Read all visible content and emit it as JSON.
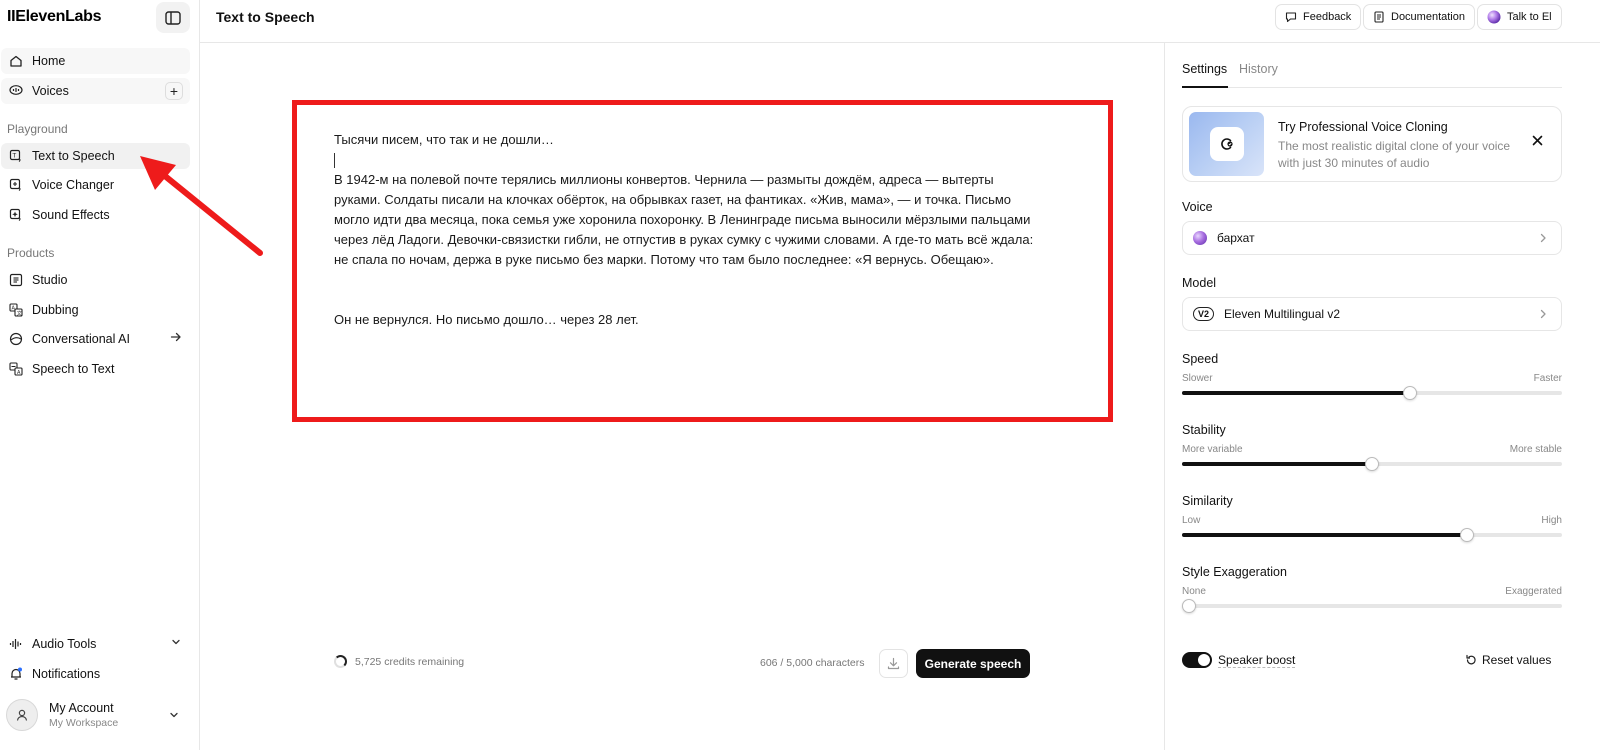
{
  "sidebar": {
    "logo": "IIElevenLabs",
    "items_top": [
      {
        "label": "Home",
        "icon": "home-icon"
      },
      {
        "label": "Voices",
        "icon": "voices-icon",
        "add": "+"
      }
    ],
    "sections": [
      {
        "label": "Playground"
      },
      {
        "label": "Products"
      }
    ],
    "playground_items": [
      {
        "label": "Text to Speech",
        "icon": "text-to-speech-icon"
      },
      {
        "label": "Voice Changer",
        "icon": "voice-changer-icon"
      },
      {
        "label": "Sound Effects",
        "icon": "sound-effects-icon"
      }
    ],
    "product_items": [
      {
        "label": "Studio",
        "icon": "studio-icon"
      },
      {
        "label": "Dubbing",
        "icon": "dubbing-icon"
      },
      {
        "label": "Conversational AI",
        "icon": "conversational-ai-icon"
      },
      {
        "label": "Speech to Text",
        "icon": "speech-to-text-icon"
      }
    ],
    "bottom_items": [
      {
        "label": "Audio Tools",
        "icon": "audio-tools-icon"
      },
      {
        "label": "Notifications",
        "icon": "bell-icon"
      }
    ],
    "account": {
      "name": "My Account",
      "workspace": "My Workspace"
    }
  },
  "header": {
    "title": "Text to Speech",
    "buttons": [
      {
        "label": "Feedback",
        "icon": "feedback-icon"
      },
      {
        "label": "Documentation",
        "icon": "document-icon"
      },
      {
        "label": "Talk to El",
        "icon": "orb-icon"
      }
    ]
  },
  "editor": {
    "paragraph1": "Тысячи писем, что так и не дошли…",
    "paragraph2": "В 1942-м на полевой почте терялись миллионы конвертов. Чернила — размыты дождём, адреса — вытерты руками. Солдаты писали на клочках обёрток, на обрывках газет, на фантиках. «Жив, мама», — и точка. Письмо могло идти два месяца, пока семья уже хоронила похоронку. В Ленинграде письма выносили мёрзлыми пальцами через лёд Ладоги. Девочки-связистки гибли, не отпустив в руках сумку с чужими словами. А где-то мать всё ждала: не спала по ночам, держа в руке письмо без марки. Потому что там было последнее: «Я вернусь. Обещаю».",
    "paragraph3": "Он не вернулся. Но письмо дошло… через 28 лет."
  },
  "footer": {
    "credits": "5,725 credits remaining",
    "characters": "606 / 5,000 characters",
    "generate_label": "Generate speech"
  },
  "settings": {
    "tabs": [
      {
        "label": "Settings"
      },
      {
        "label": "History"
      }
    ],
    "promo": {
      "title": "Try Professional Voice Cloning",
      "description": "The most realistic digital clone of your voice with just 30 minutes of audio"
    },
    "voice": {
      "label": "Voice",
      "value": "бархат"
    },
    "model": {
      "label": "Model",
      "badge": "V2",
      "value": "Eleven Multilingual v2"
    },
    "sliders": [
      {
        "label": "Speed",
        "min_label": "Slower",
        "max_label": "Faster",
        "value": 0.6
      },
      {
        "label": "Stability",
        "min_label": "More variable",
        "max_label": "More stable",
        "value": 0.5
      },
      {
        "label": "Similarity",
        "min_label": "Low",
        "max_label": "High",
        "value": 0.75
      },
      {
        "label": "Style Exaggeration",
        "min_label": "None",
        "max_label": "Exaggerated",
        "value": 0.0
      }
    ],
    "speaker_boost": {
      "label": "Speaker boost",
      "enabled": true
    },
    "reset_label": "Reset values"
  },
  "colors": {
    "highlight_frame": "#ee1b1b",
    "primary": "#111111",
    "annotation_arrow": "#ee1b1b"
  }
}
